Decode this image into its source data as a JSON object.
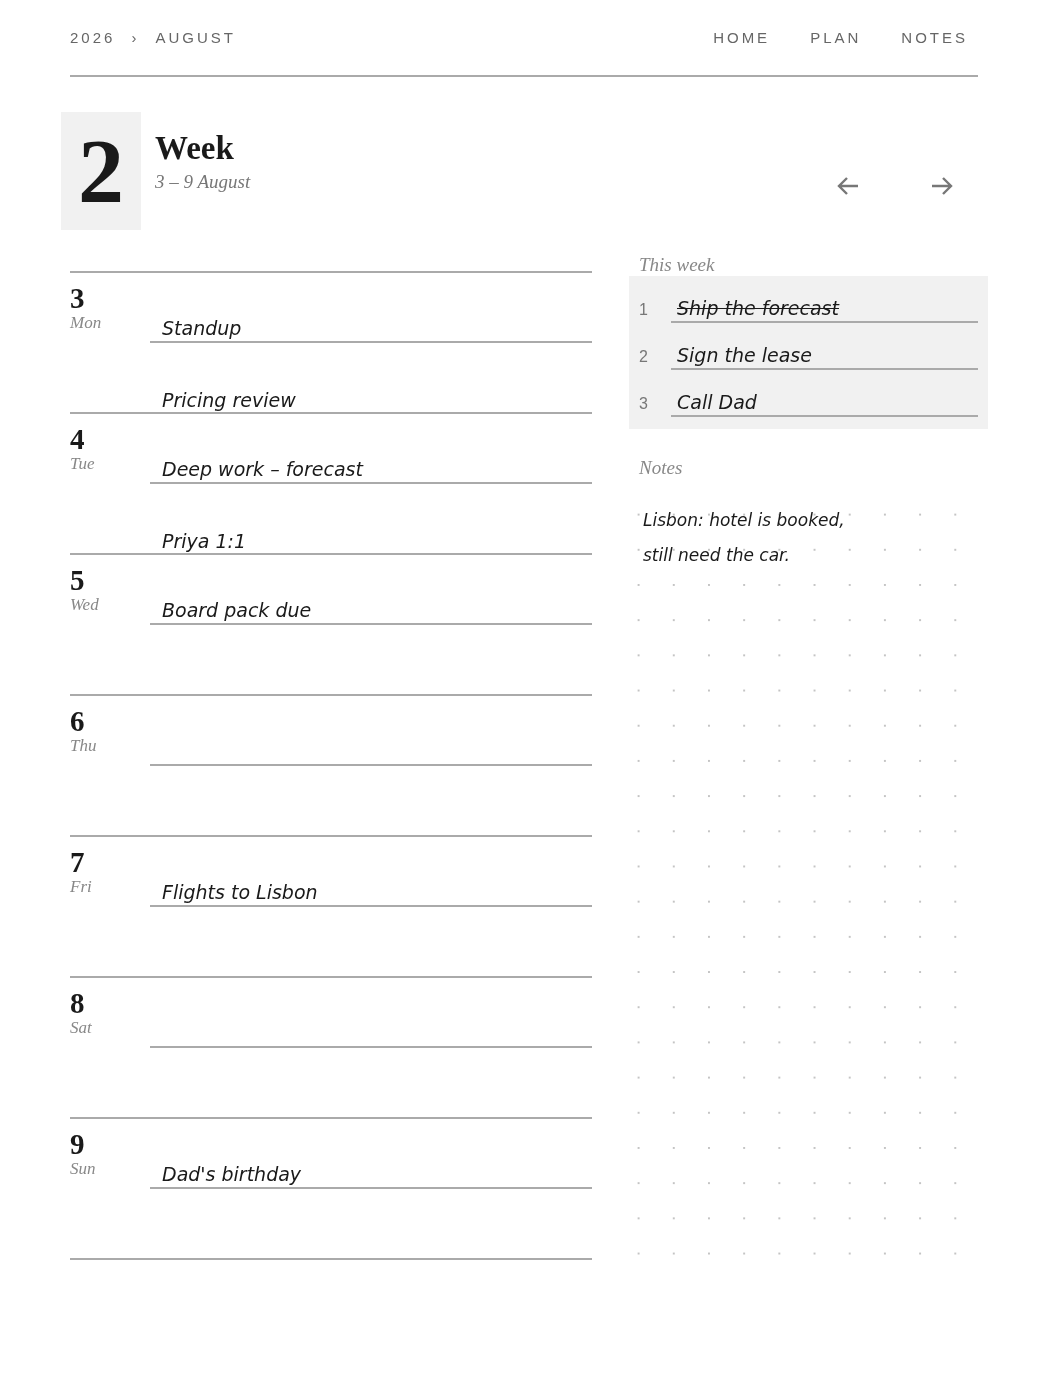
{
  "breadcrumb": {
    "year": "2026",
    "separator": "›",
    "month": "AUGUST"
  },
  "nav": [
    {
      "label": "HOME"
    },
    {
      "label": "PLAN"
    },
    {
      "label": "NOTES"
    }
  ],
  "week": {
    "number": "2",
    "title": "Week",
    "range": "3 – 9 August"
  },
  "days": [
    {
      "number": "3",
      "weekday": "Mon",
      "entries": [
        "Standup",
        "Pricing review"
      ]
    },
    {
      "number": "4",
      "weekday": "Tue",
      "entries": [
        "Deep work – forecast",
        "Priya 1:1"
      ]
    },
    {
      "number": "5",
      "weekday": "Wed",
      "entries": [
        "Board pack due"
      ]
    },
    {
      "number": "6",
      "weekday": "Thu"
    },
    {
      "number": "7",
      "weekday": "Fri",
      "entries": [
        "Flights to Lisbon"
      ]
    },
    {
      "number": "8",
      "weekday": "Sat"
    },
    {
      "number": "9",
      "weekday": "Sun",
      "entries": [
        "Dad's birthday"
      ]
    }
  ],
  "this_week": {
    "title": "This week",
    "tasks": [
      {
        "number": "1",
        "text": "Ship the forecast",
        "done": true
      },
      {
        "number": "2",
        "text": "Sign the lease",
        "done": false
      },
      {
        "number": "3",
        "text": "Call Dad",
        "done": false
      }
    ]
  },
  "notes": {
    "title": "Notes",
    "lines": [
      "Lisbon: hotel is booked,",
      "still need the car."
    ]
  }
}
